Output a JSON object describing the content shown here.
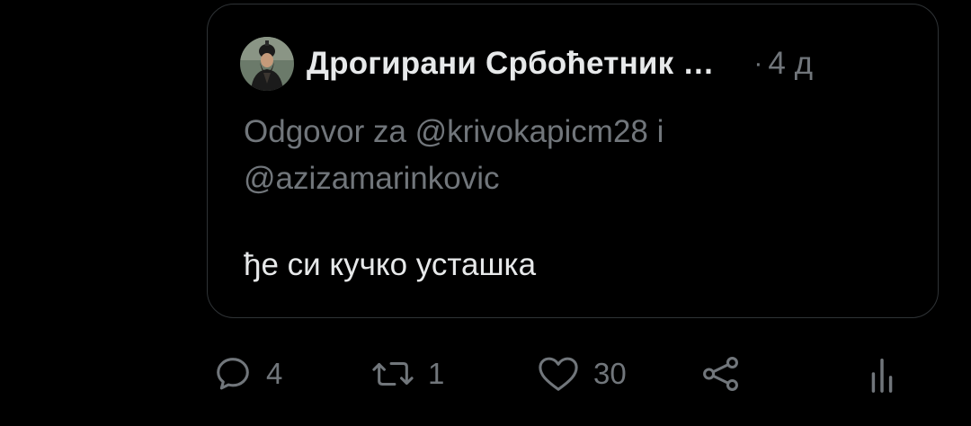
{
  "quote": {
    "author_name": "Дрогирани Србоћетник",
    "ellipsis": "…",
    "dot": "·",
    "timestamp": "4 д",
    "avatar_icon": "avatar-priest-icon",
    "reply_to_line1": "Odgovor za @krivokapicm28 i",
    "reply_to_line2": "@azizamarinkovic",
    "text": "ђе си кучко усташка"
  },
  "actions": {
    "reply_count": "4",
    "retweet_count": "1",
    "like_count": "30",
    "share_icon": "share-icon",
    "stats_icon": "stats-icon"
  },
  "colors": {
    "background": "#000000",
    "text_primary": "#e7e9ea",
    "text_secondary": "#71767b",
    "border": "#2f3336"
  }
}
